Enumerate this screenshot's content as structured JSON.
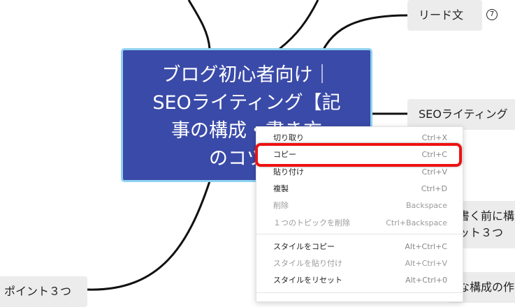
{
  "central_topic": {
    "lines": [
      "ブログ初心者向け｜",
      "SEOライティング【記",
      "事の構成・書き方",
      "のコツ】"
    ]
  },
  "topics": {
    "lead": "リード文",
    "lead_count": "7",
    "seo": "SEOライティング",
    "before_write": "書く前に構",
    "points_right": "ット３つ",
    "structure": "な構成の作",
    "points_left": "ポイント３つ"
  },
  "context_menu": {
    "items": [
      {
        "label": "切り取り",
        "shortcut": "Ctrl+X",
        "enabled": true
      },
      {
        "label": "コピー",
        "shortcut": "Ctrl+C",
        "enabled": true
      },
      {
        "label": "貼り付け",
        "shortcut": "Ctrl+V",
        "enabled": true
      },
      {
        "label": "複製",
        "shortcut": "Ctrl+D",
        "enabled": true
      },
      {
        "label": "削除",
        "shortcut": "Backspace",
        "enabled": false
      },
      {
        "label": "１つのトピックを削除",
        "shortcut": "Ctrl+Backspace",
        "enabled": false
      },
      {
        "label": "スタイルをコピー",
        "shortcut": "Alt+Ctrl+C",
        "enabled": true
      },
      {
        "label": "スタイルを貼り付け",
        "shortcut": "Alt+Ctrl+V",
        "enabled": false
      },
      {
        "label": "スタイルをリセット",
        "shortcut": "Alt+Ctrl+0",
        "enabled": true
      }
    ]
  },
  "colors": {
    "central_bg": "#3a4aa8",
    "central_border": "#8fd3f1",
    "topic_bg": "#ececec",
    "highlight": "#ee1111"
  }
}
